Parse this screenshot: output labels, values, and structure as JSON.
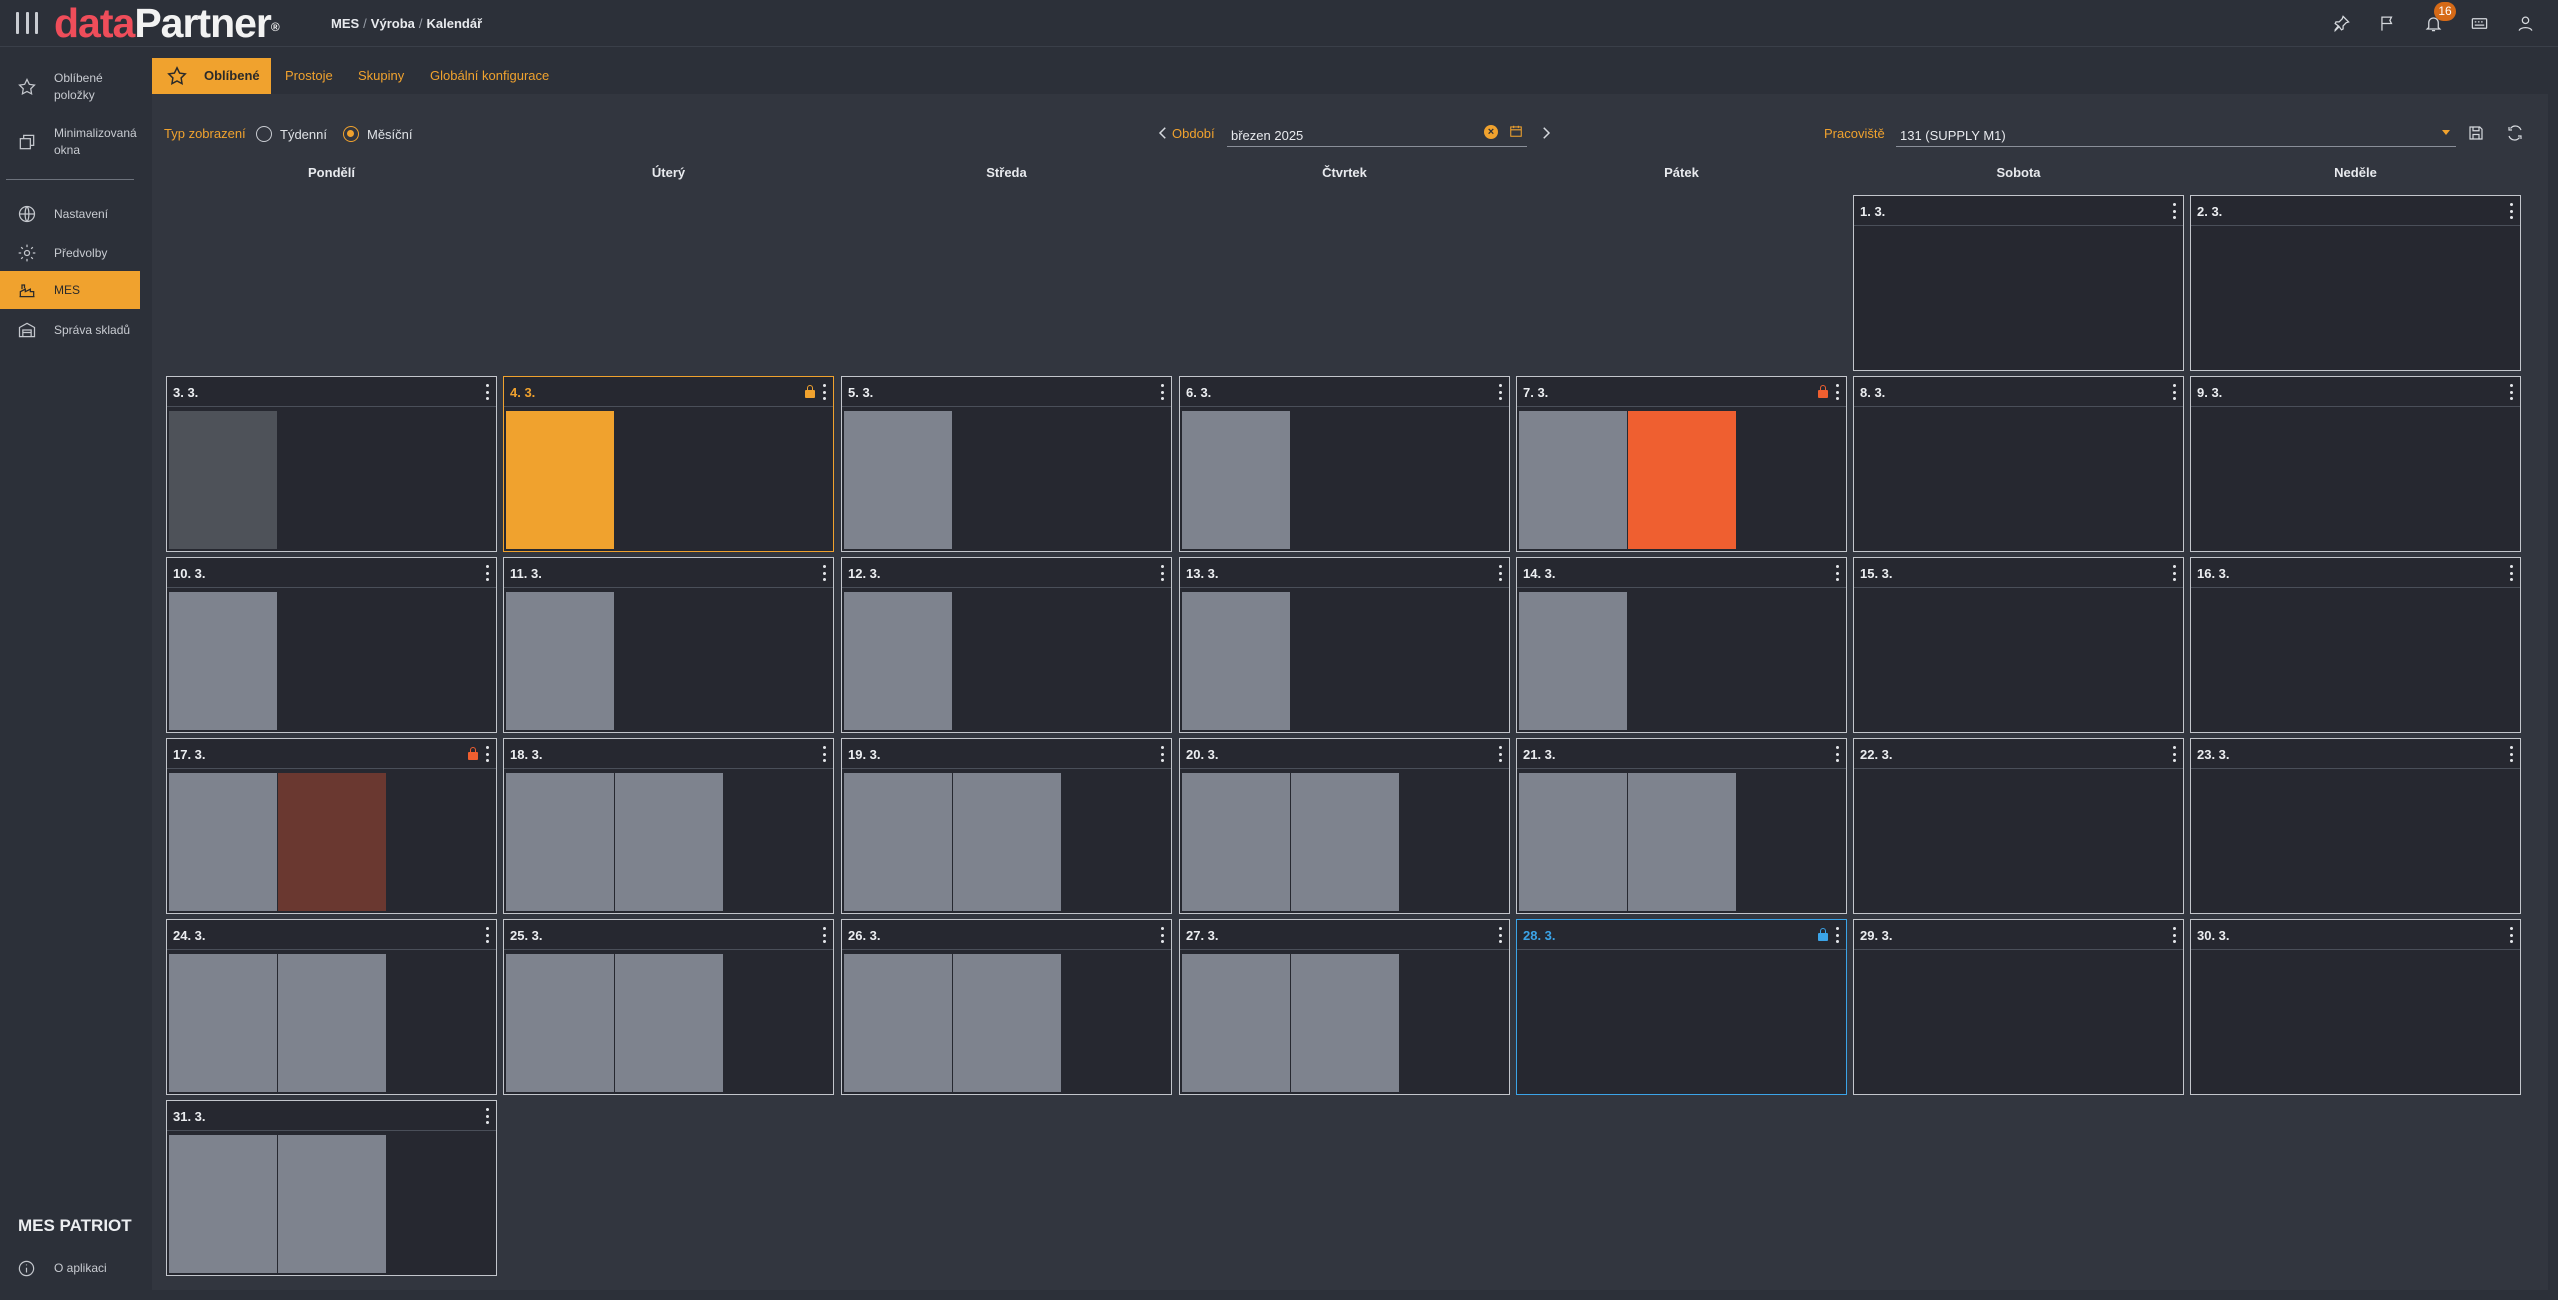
{
  "app": {
    "logo_part1": "data",
    "logo_part2": "Partner",
    "logo_reg": "®",
    "breadcrumb": [
      "MES",
      "Výroba",
      "Kalendář"
    ],
    "notification_count": "16",
    "top_icons": [
      "pin-icon",
      "flag-icon",
      "bell-icon",
      "keyboard-icon",
      "user-icon"
    ]
  },
  "sidebar": {
    "items": [
      {
        "label": "Oblíbené položky",
        "icon": "star-icon"
      },
      {
        "label": "Minimalizovaná okna",
        "icon": "windows-icon"
      },
      {
        "label": "Nastavení",
        "icon": "globe-icon"
      },
      {
        "label": "Předvolby",
        "icon": "gear-icon"
      },
      {
        "label": "MES",
        "icon": "factory-icon",
        "active": true
      },
      {
        "label": "Správa skladů",
        "icon": "warehouse-icon"
      }
    ],
    "product_name": "MES PATRIOT",
    "about_label": "O aplikaci"
  },
  "tabs": [
    {
      "label": "Oblíbené",
      "active": true
    },
    {
      "label": "Prostoje"
    },
    {
      "label": "Skupiny"
    },
    {
      "label": "Globální konfigurace"
    }
  ],
  "filters": {
    "view_type_label": "Typ zobrazení",
    "weekly_label": "Týdenní",
    "monthly_label": "Měsíční",
    "selected_view": "monthly",
    "period_label": "Období",
    "period_value": "březen 2025",
    "workplace_label": "Pracoviště",
    "workplace_value": "131 (SUPPLY M1)"
  },
  "calendar": {
    "weekdays": [
      "Pondělí",
      "Úterý",
      "Středa",
      "Čtvrtek",
      "Pátek",
      "Sobota",
      "Neděle"
    ],
    "colors": {
      "grey": "#7e838e",
      "darkgrey": "#4e5259",
      "orange": "#f0a22e",
      "red": "#ef5f30",
      "brown": "#6a3830",
      "lock_orange": "#f0a22e",
      "lock_red": "#ef5f30",
      "lock_blue": "#3ba4e8"
    },
    "days": [
      {
        "label": "1. 3.",
        "row": 0,
        "col": 5,
        "shifts": []
      },
      {
        "label": "2. 3.",
        "row": 0,
        "col": 6,
        "shifts": []
      },
      {
        "label": "3. 3.",
        "row": 1,
        "col": 0,
        "shifts": [
          "darkgrey"
        ]
      },
      {
        "label": "4. 3.",
        "row": 1,
        "col": 1,
        "shifts": [
          "orange"
        ],
        "current": true,
        "lock": "lock_orange"
      },
      {
        "label": "5. 3.",
        "row": 1,
        "col": 2,
        "shifts": [
          "grey"
        ]
      },
      {
        "label": "6. 3.",
        "row": 1,
        "col": 3,
        "shifts": [
          "grey"
        ]
      },
      {
        "label": "7. 3.",
        "row": 1,
        "col": 4,
        "shifts": [
          "grey",
          "red"
        ],
        "lock": "lock_red"
      },
      {
        "label": "8. 3.",
        "row": 1,
        "col": 5,
        "shifts": []
      },
      {
        "label": "9. 3.",
        "row": 1,
        "col": 6,
        "shifts": []
      },
      {
        "label": "10. 3.",
        "row": 2,
        "col": 0,
        "shifts": [
          "grey"
        ]
      },
      {
        "label": "11. 3.",
        "row": 2,
        "col": 1,
        "shifts": [
          "grey"
        ]
      },
      {
        "label": "12. 3.",
        "row": 2,
        "col": 2,
        "shifts": [
          "grey"
        ]
      },
      {
        "label": "13. 3.",
        "row": 2,
        "col": 3,
        "shifts": [
          "grey"
        ]
      },
      {
        "label": "14. 3.",
        "row": 2,
        "col": 4,
        "shifts": [
          "grey"
        ]
      },
      {
        "label": "15. 3.",
        "row": 2,
        "col": 5,
        "shifts": []
      },
      {
        "label": "16. 3.",
        "row": 2,
        "col": 6,
        "shifts": []
      },
      {
        "label": "17. 3.",
        "row": 3,
        "col": 0,
        "shifts": [
          "grey",
          "brown"
        ],
        "lock": "lock_red"
      },
      {
        "label": "18. 3.",
        "row": 3,
        "col": 1,
        "shifts": [
          "grey",
          "grey"
        ]
      },
      {
        "label": "19. 3.",
        "row": 3,
        "col": 2,
        "shifts": [
          "grey",
          "grey"
        ]
      },
      {
        "label": "20. 3.",
        "row": 3,
        "col": 3,
        "shifts": [
          "grey",
          "grey"
        ]
      },
      {
        "label": "21. 3.",
        "row": 3,
        "col": 4,
        "shifts": [
          "grey",
          "grey"
        ]
      },
      {
        "label": "22. 3.",
        "row": 3,
        "col": 5,
        "shifts": []
      },
      {
        "label": "23. 3.",
        "row": 3,
        "col": 6,
        "shifts": []
      },
      {
        "label": "24. 3.",
        "row": 4,
        "col": 0,
        "shifts": [
          "grey",
          "grey"
        ]
      },
      {
        "label": "25. 3.",
        "row": 4,
        "col": 1,
        "shifts": [
          "grey",
          "grey"
        ]
      },
      {
        "label": "26. 3.",
        "row": 4,
        "col": 2,
        "shifts": [
          "grey",
          "grey"
        ]
      },
      {
        "label": "27. 3.",
        "row": 4,
        "col": 3,
        "shifts": [
          "grey",
          "grey"
        ]
      },
      {
        "label": "28. 3.",
        "row": 4,
        "col": 4,
        "shifts": [],
        "today": true,
        "lock": "lock_blue"
      },
      {
        "label": "29. 3.",
        "row": 4,
        "col": 5,
        "shifts": []
      },
      {
        "label": "30. 3.",
        "row": 4,
        "col": 6,
        "shifts": []
      },
      {
        "label": "31. 3.",
        "row": 5,
        "col": 0,
        "shifts": [
          "grey",
          "grey"
        ]
      }
    ]
  }
}
